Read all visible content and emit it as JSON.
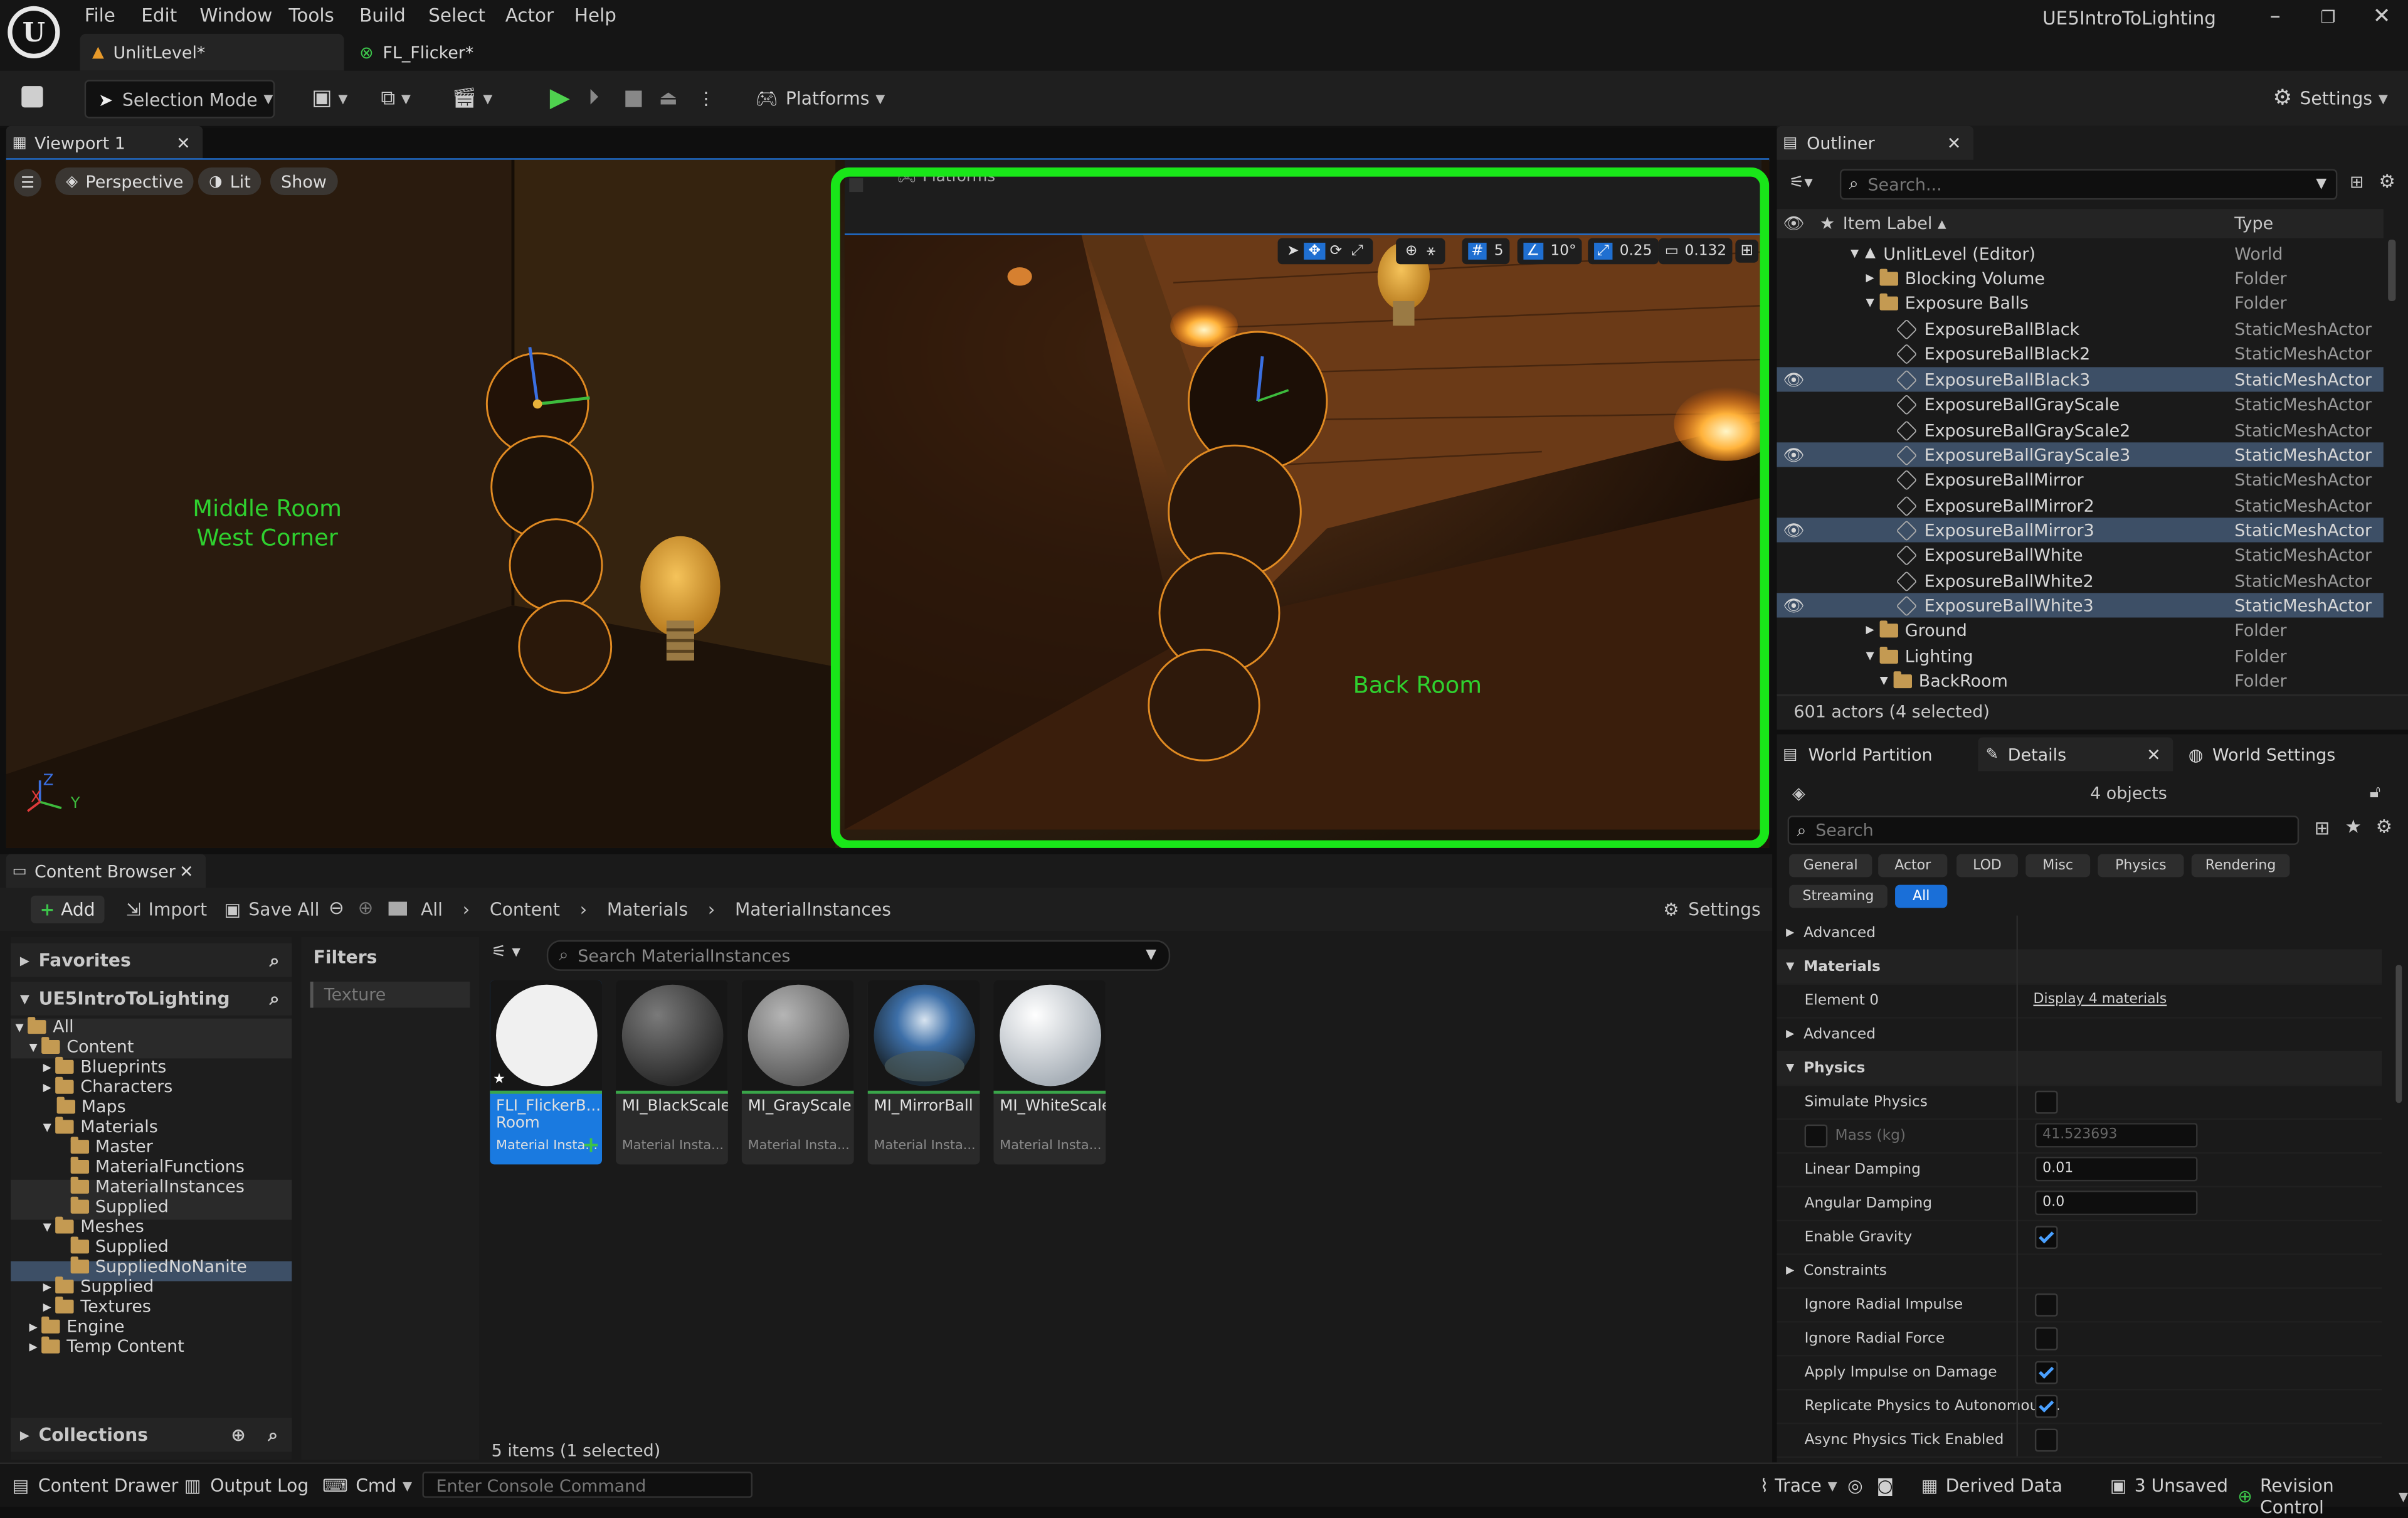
{
  "app": {
    "project_name": "UE5IntroToLighting",
    "menu": [
      "File",
      "Edit",
      "Window",
      "Tools",
      "Build",
      "Select",
      "Actor",
      "Help"
    ],
    "tabs": [
      {
        "label": "UnlitLevel*"
      },
      {
        "label": "FL_Flicker*"
      }
    ]
  },
  "toolbar": {
    "mode_label": "Selection Mode",
    "platforms_label": "Platforms",
    "settings_label": "Settings"
  },
  "viewport": {
    "tab_label": "Viewport 1",
    "perspective_label": "Perspective",
    "lit_label": "Lit",
    "show_label": "Show",
    "left_annotation_line1": "Middle Room",
    "left_annotation_line2": "West Corner",
    "right_annotation": "Back Room",
    "inner_platforms_label": "Platforms",
    "grid_snap": "5",
    "rotation_snap": "10°",
    "scale_snap": "0.25",
    "camera_speed": "0.132",
    "axis_x": "X",
    "axis_y": "Y",
    "axis_z": "Z",
    "highlight_color": "#19e619"
  },
  "content_browser": {
    "tab_label": "Content Browser",
    "add_label": "Add",
    "import_label": "Import",
    "save_all_label": "Save All",
    "breadcrumb": [
      "All",
      "Content",
      "Materials",
      "MaterialInstances"
    ],
    "settings_label": "Settings",
    "favorites_label": "Favorites",
    "project_root": "UE5IntroToLighting",
    "filters_label": "Filters",
    "filter_chip": "Texture",
    "search_placeholder": "Search MaterialInstances",
    "tree": [
      {
        "label": "All"
      },
      {
        "label": "Content"
      },
      {
        "label": "Blueprints"
      },
      {
        "label": "Characters"
      },
      {
        "label": "Maps"
      },
      {
        "label": "Materials"
      },
      {
        "label": "Master"
      },
      {
        "label": "MaterialFunctions"
      },
      {
        "label": "MaterialInstances"
      },
      {
        "label": "Supplied"
      },
      {
        "label": "Meshes"
      },
      {
        "label": "Supplied"
      },
      {
        "label": "SuppliedNoNanite"
      },
      {
        "label": "Supplied"
      },
      {
        "label": "Textures"
      },
      {
        "label": "Engine"
      },
      {
        "label": "Temp Content"
      }
    ],
    "assets": [
      {
        "name": "FLI_FlickerB... Room",
        "type": "Material Insta..."
      },
      {
        "name": "MI_BlackScale",
        "type": "Material Insta..."
      },
      {
        "name": "MI_GrayScale",
        "type": "Material Insta..."
      },
      {
        "name": "MI_MirrorBall",
        "type": "Material Insta..."
      },
      {
        "name": "MI_WhiteScale",
        "type": "Material Insta..."
      }
    ],
    "item_count": "5 items (1 selected)",
    "collections_label": "Collections"
  },
  "outliner": {
    "tab_label": "Outliner",
    "search_placeholder": "Search...",
    "col_label": "Item Label",
    "col_type": "Type",
    "rows": [
      {
        "label": "UnlitLevel (Editor)",
        "type": "World"
      },
      {
        "label": "Blocking Volume",
        "type": "Folder"
      },
      {
        "label": "Exposure Balls",
        "type": "Folder"
      },
      {
        "label": "ExposureBallBlack",
        "type": "StaticMeshActor"
      },
      {
        "label": "ExposureBallBlack2",
        "type": "StaticMeshActor"
      },
      {
        "label": "ExposureBallBlack3",
        "type": "StaticMeshActor"
      },
      {
        "label": "ExposureBallGrayScale",
        "type": "StaticMeshActor"
      },
      {
        "label": "ExposureBallGrayScale2",
        "type": "StaticMeshActor"
      },
      {
        "label": "ExposureBallGrayScale3",
        "type": "StaticMeshActor"
      },
      {
        "label": "ExposureBallMirror",
        "type": "StaticMeshActor"
      },
      {
        "label": "ExposureBallMirror2",
        "type": "StaticMeshActor"
      },
      {
        "label": "ExposureBallMirror3",
        "type": "StaticMeshActor"
      },
      {
        "label": "ExposureBallWhite",
        "type": "StaticMeshActor"
      },
      {
        "label": "ExposureBallWhite2",
        "type": "StaticMeshActor"
      },
      {
        "label": "ExposureBallWhite3",
        "type": "StaticMeshActor"
      },
      {
        "label": "Ground",
        "type": "Folder"
      },
      {
        "label": "Lighting",
        "type": "Folder"
      },
      {
        "label": "BackRoom",
        "type": "Folder"
      }
    ],
    "actor_count": "601 actors (4 selected)"
  },
  "details": {
    "tabs": [
      {
        "label": "World Partition"
      },
      {
        "label": "Details"
      },
      {
        "label": "World Settings"
      }
    ],
    "objects_label": "4 objects",
    "search_placeholder": "Search",
    "filter_chips": [
      "General",
      "Actor",
      "LOD",
      "Misc",
      "Physics",
      "Rendering",
      "Streaming",
      "All"
    ],
    "rows": {
      "advanced1": "Advanced",
      "materials": "Materials",
      "element0": "Element 0",
      "display_materials": "Display 4 materials",
      "advanced2": "Advanced",
      "physics": "Physics",
      "simulate_physics": "Simulate Physics",
      "mass": "Mass (kg)",
      "mass_value": "41.523693",
      "linear_damping": "Linear Damping",
      "linear_damping_value": "0.01",
      "angular_damping": "Angular Damping",
      "angular_damping_value": "0.0",
      "enable_gravity": "Enable Gravity",
      "constraints": "Constraints",
      "ignore_radial_impulse": "Ignore Radial Impulse",
      "ignore_radial_force": "Ignore Radial Force",
      "apply_impulse": "Apply Impulse on Damage",
      "replicate_physics": "Replicate Physics to Autonomous...",
      "async_physics": "Async Physics Tick Enabled"
    }
  },
  "statusbar": {
    "content_drawer": "Content Drawer",
    "output_log": "Output Log",
    "cmd": "Cmd",
    "console_placeholder": "Enter Console Command",
    "trace": "Trace",
    "derived_data": "Derived Data",
    "unsaved": "3 Unsaved",
    "revision_control": "Revision Control"
  }
}
